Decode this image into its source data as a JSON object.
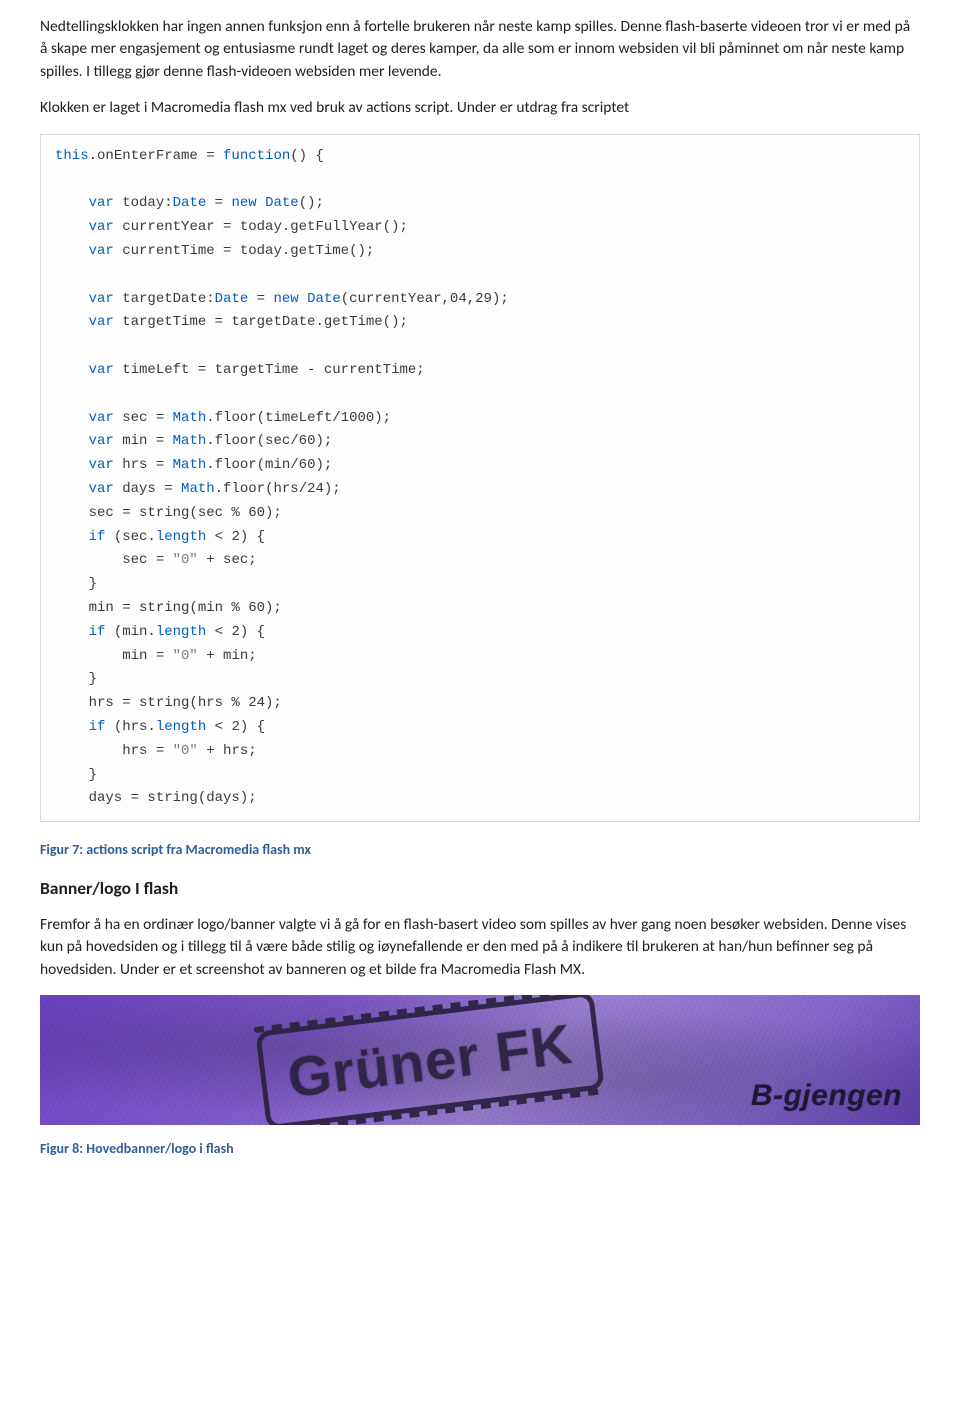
{
  "intro_paragraph": "Nedtellingsklokken har ingen annen funksjon enn å fortelle brukeren når neste kamp spilles. Denne flash-baserte videoen tror vi er med på å skape mer engasjement og entusiasme rundt laget og deres kamper, da alle som er innom websiden vil bli påminnet om når neste kamp spilles. I tillegg gjør denne flash-videoen websiden mer levende.",
  "second_paragraph": "Klokken er laget i Macromedia flash mx ved bruk av actions script. Under er utdrag fra scriptet",
  "code_lines": [
    {
      "segments": [
        {
          "t": "this",
          "c": "kw"
        },
        {
          "t": ".onEnterFrame = ",
          "c": ""
        },
        {
          "t": "function",
          "c": "kw"
        },
        {
          "t": "() {",
          "c": ""
        }
      ]
    },
    {
      "segments": [
        {
          "t": "",
          "c": ""
        }
      ]
    },
    {
      "segments": [
        {
          "t": "    ",
          "c": ""
        },
        {
          "t": "var",
          "c": "kw"
        },
        {
          "t": " today:",
          "c": ""
        },
        {
          "t": "Date",
          "c": "kw"
        },
        {
          "t": " = ",
          "c": ""
        },
        {
          "t": "new",
          "c": "kw"
        },
        {
          "t": " ",
          "c": ""
        },
        {
          "t": "Date",
          "c": "kw"
        },
        {
          "t": "();",
          "c": ""
        }
      ]
    },
    {
      "segments": [
        {
          "t": "    ",
          "c": ""
        },
        {
          "t": "var",
          "c": "kw"
        },
        {
          "t": " currentYear = today.getFullYear();",
          "c": ""
        }
      ]
    },
    {
      "segments": [
        {
          "t": "    ",
          "c": ""
        },
        {
          "t": "var",
          "c": "kw"
        },
        {
          "t": " currentTime = today.getTime();",
          "c": ""
        }
      ]
    },
    {
      "segments": [
        {
          "t": "",
          "c": ""
        }
      ]
    },
    {
      "segments": [
        {
          "t": "    ",
          "c": ""
        },
        {
          "t": "var",
          "c": "kw"
        },
        {
          "t": " targetDate:",
          "c": ""
        },
        {
          "t": "Date",
          "c": "kw"
        },
        {
          "t": " = ",
          "c": ""
        },
        {
          "t": "new",
          "c": "kw"
        },
        {
          "t": " ",
          "c": ""
        },
        {
          "t": "Date",
          "c": "kw"
        },
        {
          "t": "(currentYear,04,29);",
          "c": ""
        }
      ]
    },
    {
      "segments": [
        {
          "t": "    ",
          "c": ""
        },
        {
          "t": "var",
          "c": "kw"
        },
        {
          "t": " targetTime = targetDate.getTime();",
          "c": ""
        }
      ]
    },
    {
      "segments": [
        {
          "t": "",
          "c": ""
        }
      ]
    },
    {
      "segments": [
        {
          "t": "    ",
          "c": ""
        },
        {
          "t": "var",
          "c": "kw"
        },
        {
          "t": " timeLeft = targetTime - currentTime;",
          "c": ""
        }
      ]
    },
    {
      "segments": [
        {
          "t": "",
          "c": ""
        }
      ]
    },
    {
      "segments": [
        {
          "t": "    ",
          "c": ""
        },
        {
          "t": "var",
          "c": "kw"
        },
        {
          "t": " sec = ",
          "c": ""
        },
        {
          "t": "Math",
          "c": "kw"
        },
        {
          "t": ".floor(timeLeft/1000);",
          "c": ""
        }
      ]
    },
    {
      "segments": [
        {
          "t": "    ",
          "c": ""
        },
        {
          "t": "var",
          "c": "kw"
        },
        {
          "t": " min = ",
          "c": ""
        },
        {
          "t": "Math",
          "c": "kw"
        },
        {
          "t": ".floor(sec/60);",
          "c": ""
        }
      ]
    },
    {
      "segments": [
        {
          "t": "    ",
          "c": ""
        },
        {
          "t": "var",
          "c": "kw"
        },
        {
          "t": " hrs = ",
          "c": ""
        },
        {
          "t": "Math",
          "c": "kw"
        },
        {
          "t": ".floor(min/60);",
          "c": ""
        }
      ]
    },
    {
      "segments": [
        {
          "t": "    ",
          "c": ""
        },
        {
          "t": "var",
          "c": "kw"
        },
        {
          "t": " days = ",
          "c": ""
        },
        {
          "t": "Math",
          "c": "kw"
        },
        {
          "t": ".floor(hrs/24);",
          "c": ""
        }
      ]
    },
    {
      "segments": [
        {
          "t": "    sec = string(sec % 60);",
          "c": ""
        }
      ]
    },
    {
      "segments": [
        {
          "t": "    ",
          "c": ""
        },
        {
          "t": "if",
          "c": "kw"
        },
        {
          "t": " (sec.",
          "c": ""
        },
        {
          "t": "length",
          "c": "kw"
        },
        {
          "t": " < 2) {",
          "c": ""
        }
      ]
    },
    {
      "segments": [
        {
          "t": "        sec = ",
          "c": ""
        },
        {
          "t": "\"0\"",
          "c": "gray"
        },
        {
          "t": " + sec;",
          "c": ""
        }
      ]
    },
    {
      "segments": [
        {
          "t": "    }",
          "c": ""
        }
      ]
    },
    {
      "segments": [
        {
          "t": "    min = string(min % 60);",
          "c": ""
        }
      ]
    },
    {
      "segments": [
        {
          "t": "    ",
          "c": ""
        },
        {
          "t": "if",
          "c": "kw"
        },
        {
          "t": " (min.",
          "c": ""
        },
        {
          "t": "length",
          "c": "kw"
        },
        {
          "t": " < 2) {",
          "c": ""
        }
      ]
    },
    {
      "segments": [
        {
          "t": "        min = ",
          "c": ""
        },
        {
          "t": "\"0\"",
          "c": "gray"
        },
        {
          "t": " + min;",
          "c": ""
        }
      ]
    },
    {
      "segments": [
        {
          "t": "    }",
          "c": ""
        }
      ]
    },
    {
      "segments": [
        {
          "t": "    hrs = string(hrs % 24);",
          "c": ""
        }
      ]
    },
    {
      "segments": [
        {
          "t": "    ",
          "c": ""
        },
        {
          "t": "if",
          "c": "kw"
        },
        {
          "t": " (hrs.",
          "c": ""
        },
        {
          "t": "length",
          "c": "kw"
        },
        {
          "t": " < 2) {",
          "c": ""
        }
      ]
    },
    {
      "segments": [
        {
          "t": "        hrs = ",
          "c": ""
        },
        {
          "t": "\"0\"",
          "c": "gray"
        },
        {
          "t": " + hrs;",
          "c": ""
        }
      ]
    },
    {
      "segments": [
        {
          "t": "    }",
          "c": ""
        }
      ]
    },
    {
      "segments": [
        {
          "t": "    days = string(days);",
          "c": ""
        }
      ]
    }
  ],
  "figure7_caption": "Figur 7: actions script fra Macromedia flash mx",
  "banner_section_heading": "Banner/logo I flash",
  "banner_paragraph": "Fremfor å ha en ordinær logo/banner valgte vi å gå for en flash-basert video som spilles av hver gang noen besøker websiden. Denne vises kun på hovedsiden og i tillegg til å være både stilig og iøynefallende er den med på å indikere til brukeren at han/hun befinner seg på hovedsiden. Under er et screenshot av banneren og et bilde fra Macromedia Flash MX.",
  "banner_stamp_text": "Grüner FK",
  "banner_subbrand_text": "B-gjengen",
  "figure8_caption": "Figur 8: Hovedbanner/logo i flash"
}
